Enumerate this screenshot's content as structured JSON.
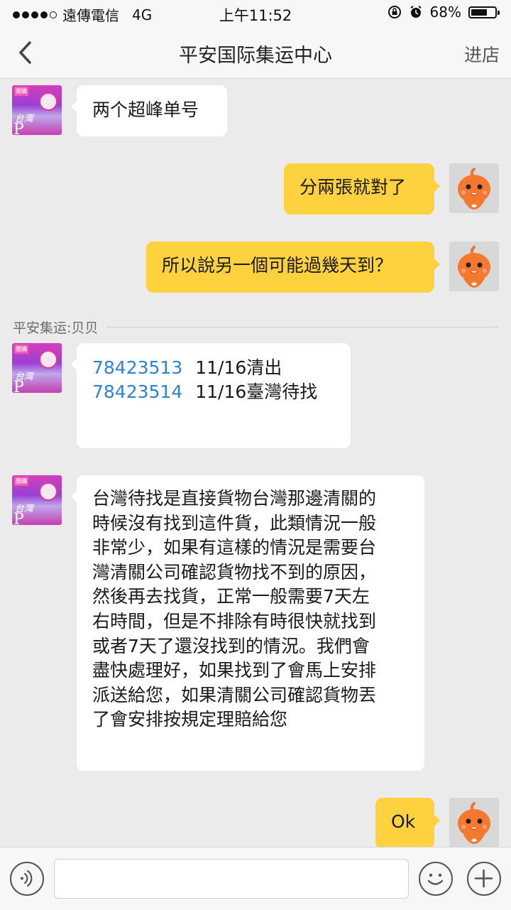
{
  "status": {
    "carrier": "遠傳電信",
    "network": "4G",
    "time": "上午11:52",
    "battery": "68%",
    "battery_level": 0.68
  },
  "nav": {
    "title": "平安国际集运中心",
    "right_action": "进店"
  },
  "messages": {
    "m1": "两个超峰单号",
    "m2": "分兩張就對了",
    "m3": "所以說另一個可能過幾天到？",
    "sender": "平安集运:贝贝",
    "tracking": [
      {
        "number": "78423513",
        "status": "11/16清出"
      },
      {
        "number": "78423514",
        "status": "11/16臺灣待找"
      }
    ],
    "m5_lines": [
      "台灣待找是直接貨物台灣那邊清關的",
      "時候沒有找到這件貨，此類情況一般",
      "非常少，如果有這樣的情況是需要台",
      "灣清關公司確認貨物找不到的原因，",
      "然後再去找貨，正常一般需要7天左",
      "右時間，但是不排除有時很快就找到",
      "或者7天了還沒找到的情況。我們會",
      "盡快處理好，如果找到了會馬上安排",
      "派送給您，如果清關公司確認貨物丟",
      "了會安排按規定理賠給您"
    ],
    "m6": "Ok"
  },
  "avatar": {
    "shop_tag": "團購",
    "shop_text": "台灣",
    "shop_letter": "P"
  },
  "colors": {
    "accent_yellow": "#fdd23e",
    "link_blue": "#2b84d5",
    "background": "#ebebeb"
  },
  "icons": [
    "chevron-left-icon",
    "voice-icon",
    "emoji-icon",
    "plus-icon",
    "user-avatar-icon",
    "shop-avatar-icon"
  ]
}
